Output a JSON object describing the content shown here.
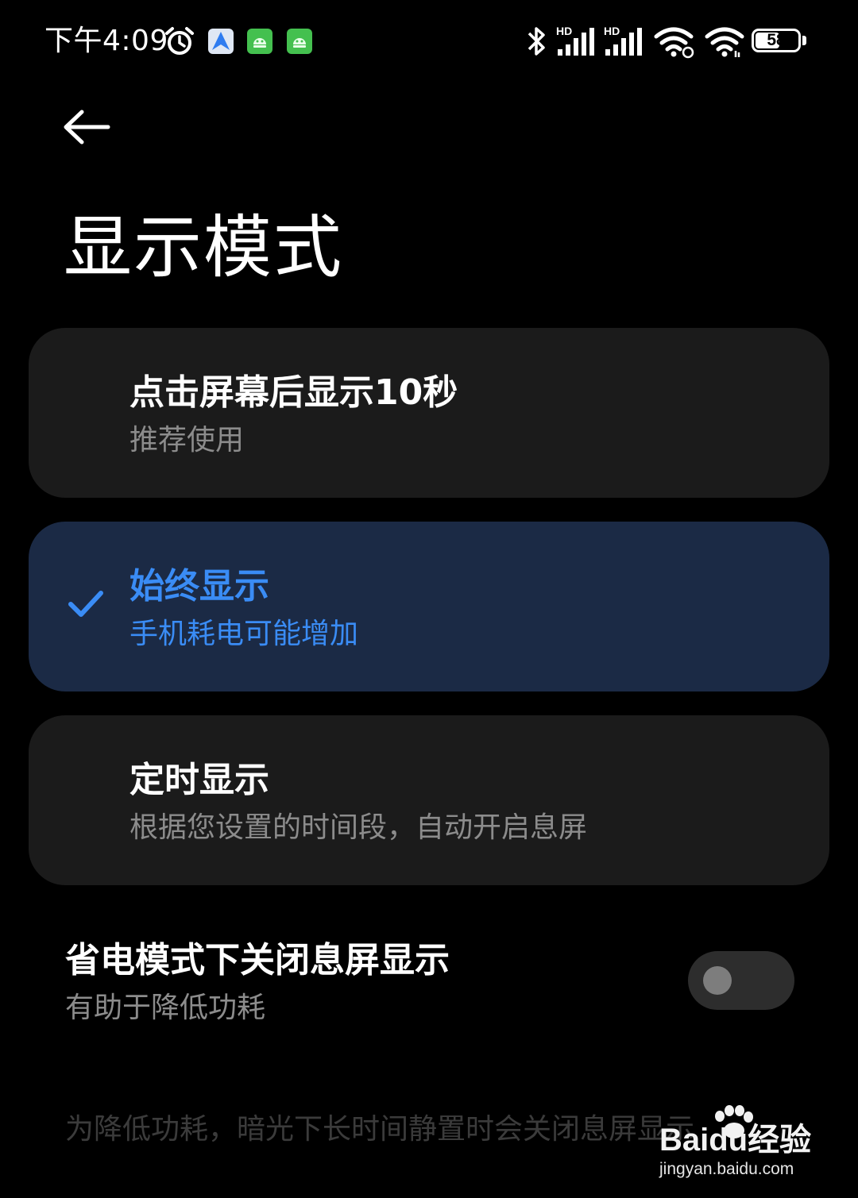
{
  "status_bar": {
    "time": "下午4:09",
    "battery_level": 58,
    "battery_text": "58",
    "network_label": "HD",
    "icons": [
      "alarm-icon",
      "maps-app-icon",
      "android-app-icon",
      "android-app-icon",
      "bluetooth-icon",
      "signal-icon",
      "signal-icon",
      "wifi-icon",
      "wifi-icon",
      "battery-icon"
    ],
    "colors": {
      "app_badge_green": "#44c04f",
      "app_badge_blue": "#2f7cf0"
    }
  },
  "header": {
    "back_icon": "back-arrow-icon",
    "title": "显示模式"
  },
  "options": [
    {
      "title": "点击屏幕后显示10秒",
      "subtitle": "推荐使用",
      "selected": false
    },
    {
      "title": "始终显示",
      "subtitle": "手机耗电可能增加",
      "selected": true
    },
    {
      "title": "定时显示",
      "subtitle": "根据您设置的时间段，自动开启息屏",
      "selected": false
    }
  ],
  "power_saving": {
    "title": "省电模式下关闭息屏显示",
    "subtitle": "有助于降低功耗",
    "enabled": false
  },
  "footnote": "为降低功耗，暗光下长时间静置时会关闭息屏显示",
  "watermark": {
    "logo": "Baidu经验",
    "url": "jingyan.baidu.com"
  },
  "colors": {
    "background": "#000000",
    "card": "#1b1b1b",
    "card_selected": "#1b2a45",
    "accent": "#3a8cf5",
    "secondary_text": "#8c8c8c"
  }
}
